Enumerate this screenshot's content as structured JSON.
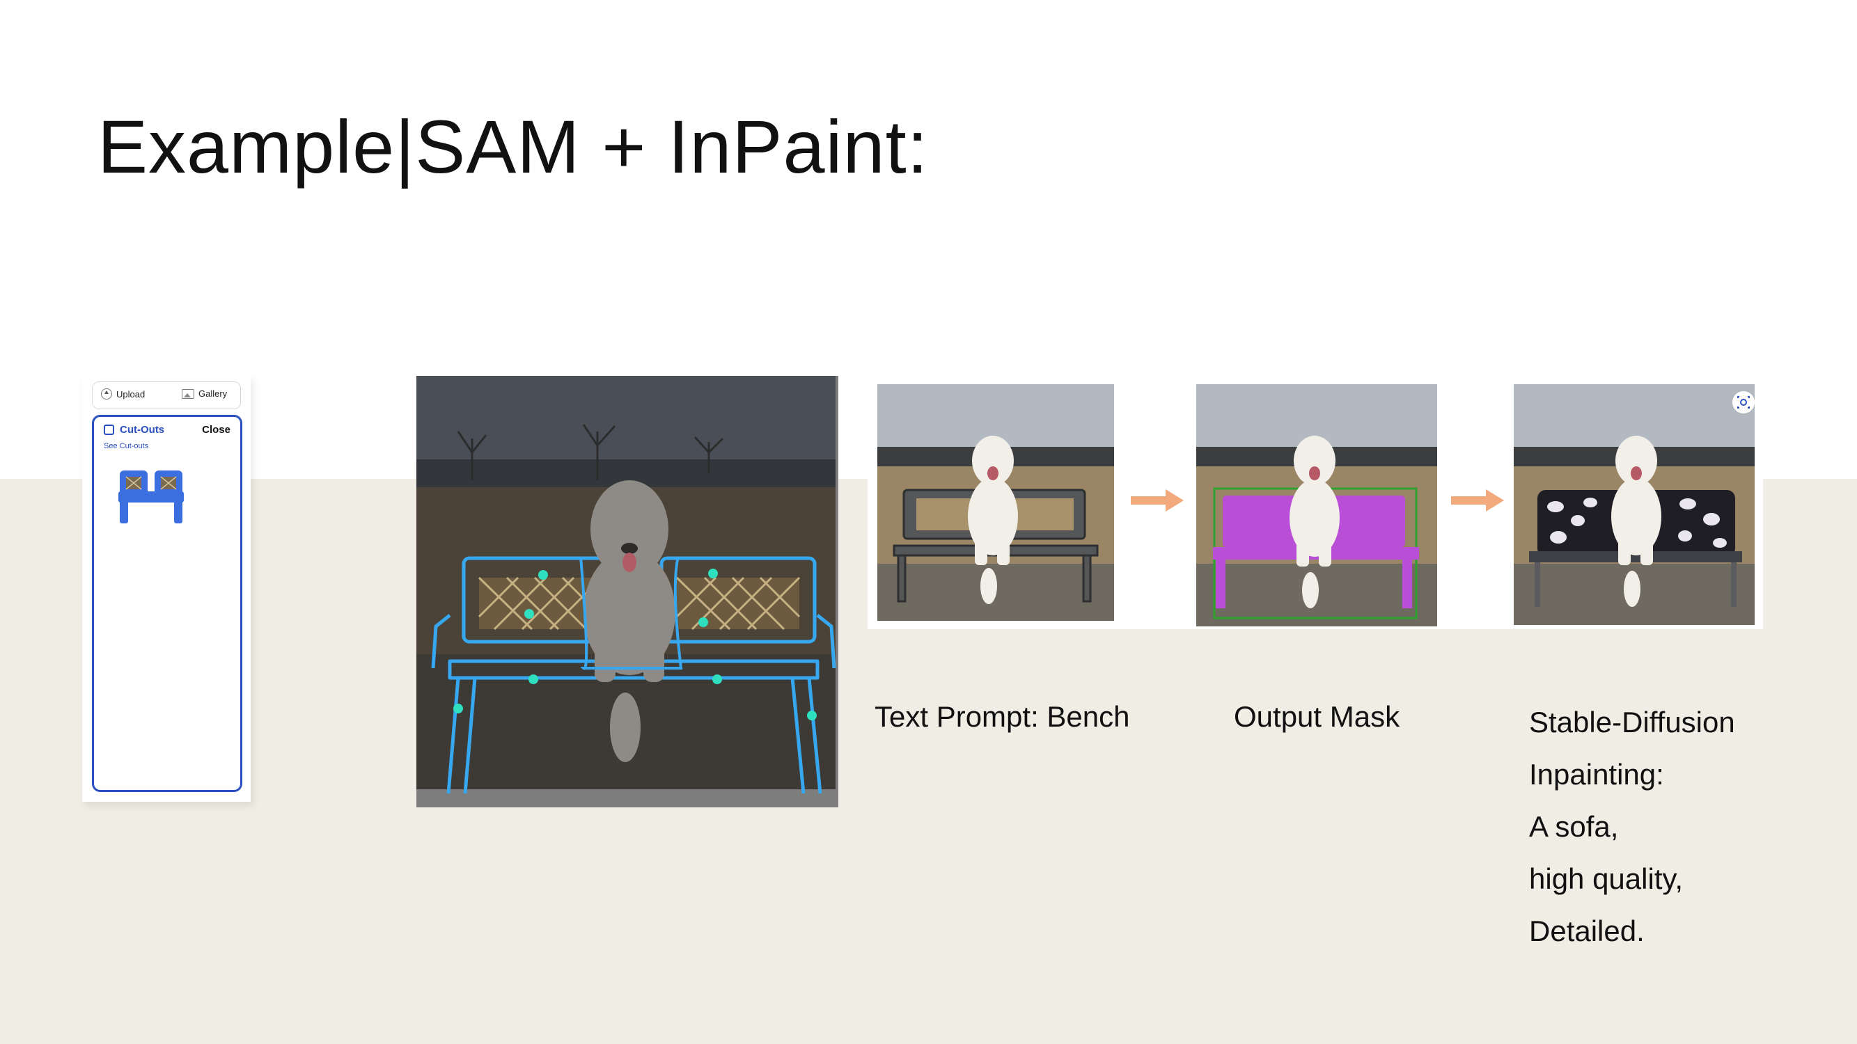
{
  "slide": {
    "title": "Example|SAM + InPaint:"
  },
  "app_panel": {
    "upload_label": "Upload",
    "gallery_label": "Gallery",
    "cutouts_title": "Cut-Outs",
    "close_label": "Close",
    "see_cutouts_link": "See Cut-outs"
  },
  "pipeline": {
    "captions": {
      "text_prompt": "Text Prompt: Bench",
      "output_mask": "Output Mask"
    },
    "inpaint_prompt_lines": [
      "Stable-Diffusion",
      "Inpainting:",
      "A sofa,",
      "high quality,",
      "Detailed."
    ]
  },
  "colors": {
    "band": "#efede4",
    "segmentation_outline": "#37a8f0",
    "mask": "#b84fd6",
    "arrow": "#f2a97b",
    "app_accent": "#2a4fc0"
  },
  "icons": [
    "upload-icon",
    "gallery-icon",
    "cutouts-icon",
    "focus-icon",
    "arrow-right-icon"
  ]
}
